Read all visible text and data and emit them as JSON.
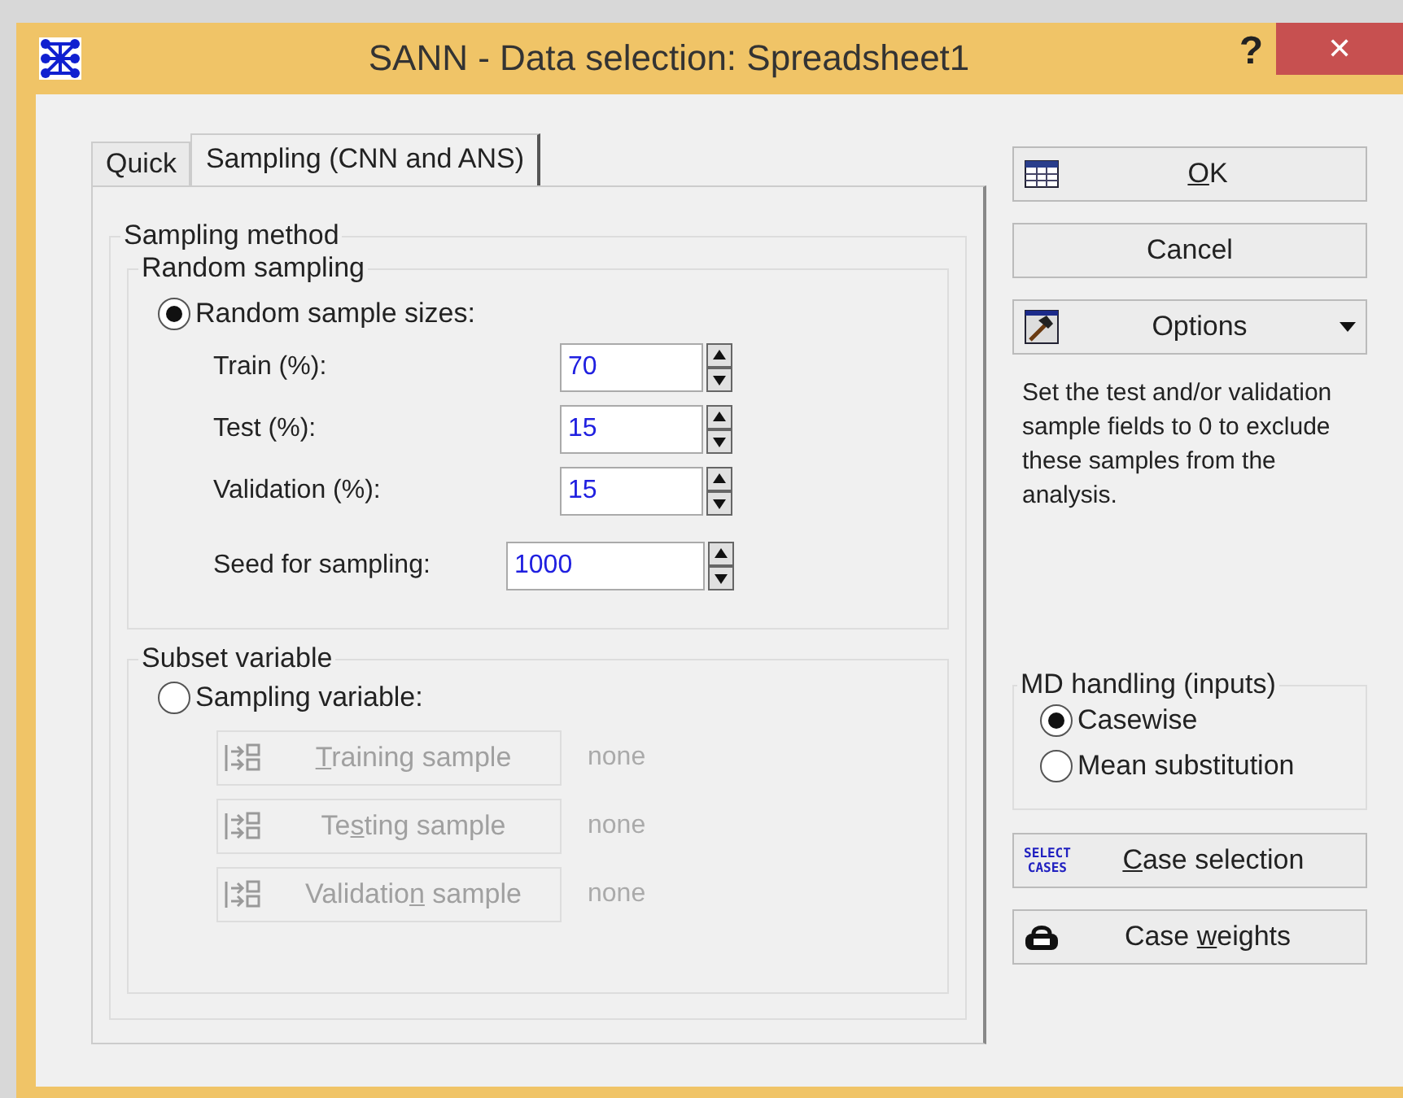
{
  "window": {
    "title": "SANN - Data selection: Spreadsheet1",
    "help": "?",
    "close": "✕"
  },
  "tabs": [
    {
      "label": "Quick",
      "selected": false
    },
    {
      "label": "Sampling (CNN and ANS)",
      "selected": true
    }
  ],
  "sampling_method": {
    "title": "Sampling method",
    "random_sampling": {
      "title": "Random sampling",
      "option": {
        "label": "Random sample sizes:",
        "selected": true
      },
      "fields": [
        {
          "label": "Train (%):",
          "value": "70"
        },
        {
          "label": "Test (%):",
          "value": "15"
        },
        {
          "label": "Validation (%):",
          "value": "15"
        },
        {
          "label": "Seed for sampling:",
          "value": "1000",
          "kind": "seed"
        }
      ]
    },
    "subset_variable": {
      "title": "Subset variable",
      "option": {
        "label": "Sampling variable:",
        "selected": false
      },
      "rows": [
        {
          "button": {
            "key": "T",
            "after": "raining sample"
          },
          "value": "none",
          "disabled": true
        },
        {
          "button": {
            "before": "Te",
            "key": "s",
            "after": "ting sample"
          },
          "value": "none",
          "disabled": true
        },
        {
          "button": {
            "before": "Validatio",
            "key": "n",
            "after": " sample"
          },
          "value": "none",
          "disabled": true
        }
      ]
    }
  },
  "buttons": [
    {
      "kind": "table",
      "key": "O",
      "after": "K"
    },
    {
      "kind": "plain",
      "before": "Cancel"
    },
    {
      "kind": "options",
      "before": "Options"
    }
  ],
  "hint": "Set the test and/or validation sample fields to 0 to exclude these samples from the analysis.",
  "md_handling": {
    "title": "MD handling (inputs)",
    "options": [
      {
        "label": "Casewise",
        "selected": true
      },
      {
        "label": "Mean substitution",
        "selected": false
      }
    ]
  },
  "bottom_buttons": [
    {
      "kind": "select",
      "icon_text": [
        "SELECT",
        "CASES"
      ],
      "key": "C",
      "after": "ase selection"
    },
    {
      "kind": "weights",
      "before": "Case ",
      "key": "w",
      "after": "eights"
    }
  ]
}
